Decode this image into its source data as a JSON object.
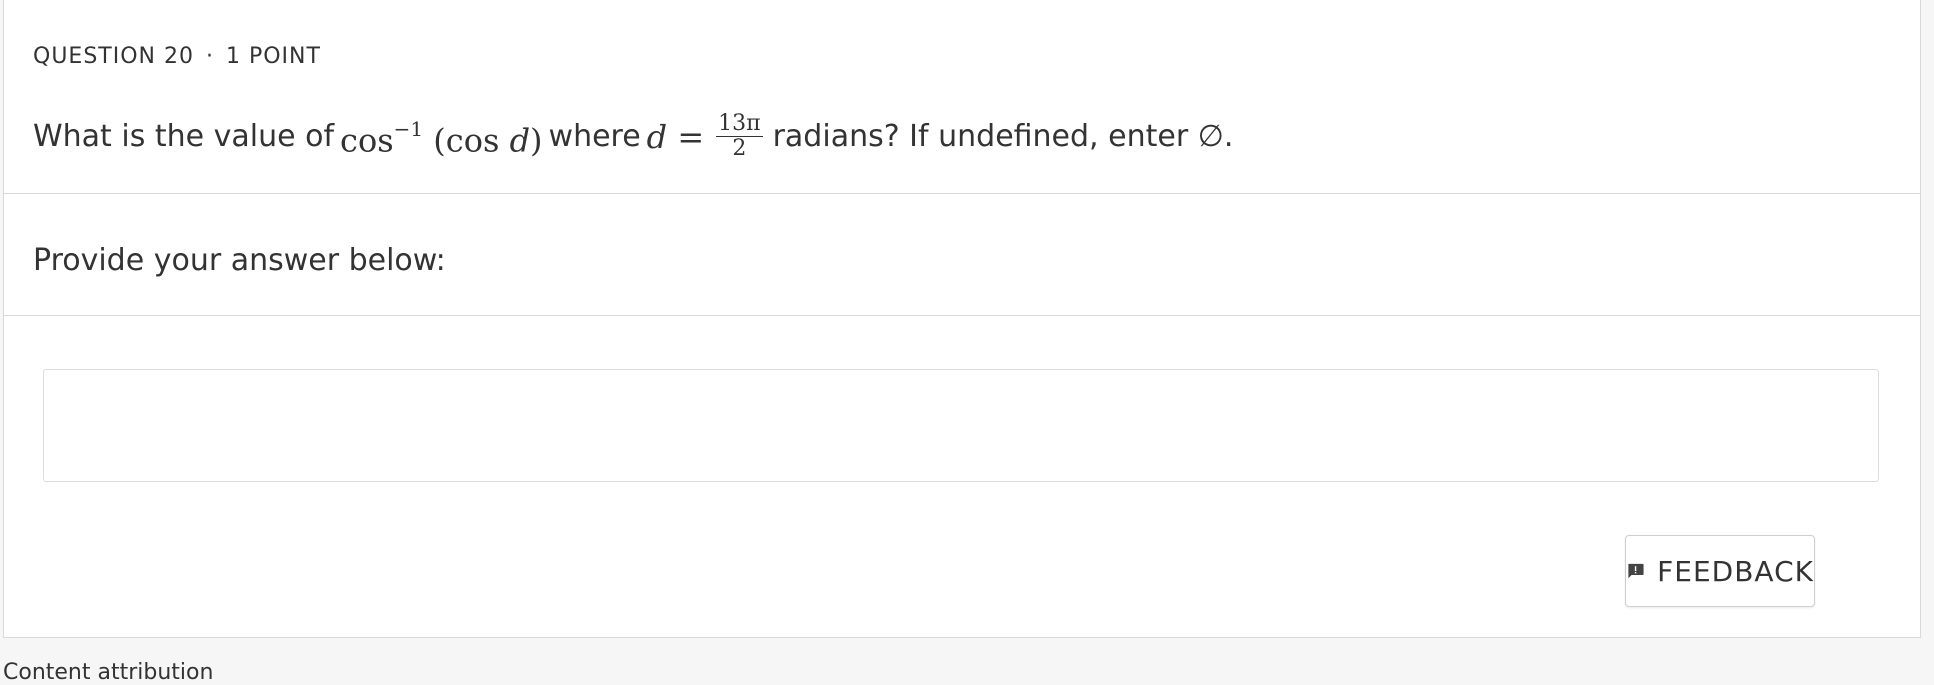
{
  "question": {
    "number_label": "QUESTION 20",
    "separator": "·",
    "points_label": "1 POINT",
    "text_before": "What is the value of",
    "math_func": "cos",
    "math_sup": "−1",
    "math_arg_open": "(cos ",
    "math_var": "d",
    "math_arg_close": ")",
    "text_where": "where",
    "math_eq_var": "d",
    "math_eq": "=",
    "frac_num": "13π",
    "frac_den": "2",
    "text_after": "radians? If undefined, enter ∅."
  },
  "answer": {
    "prompt": "Provide your answer below:",
    "value": ""
  },
  "feedback": {
    "label": "FEEDBACK",
    "icon": "feedback-icon"
  },
  "footer": {
    "attribution": "Content attribution"
  },
  "colors": {
    "text": "#333333",
    "border": "#d9d9d9",
    "background": "#f6f6f6",
    "card": "#ffffff"
  }
}
